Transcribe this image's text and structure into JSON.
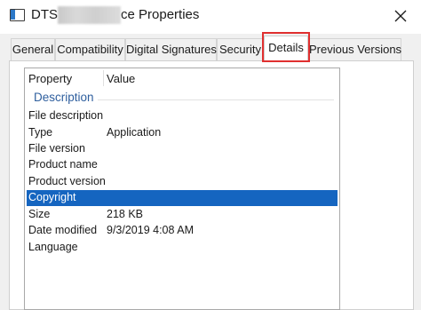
{
  "window": {
    "title_prefix": "DTS",
    "title_suffix": "ce Properties",
    "close_glyph": "close-icon"
  },
  "tabs": [
    {
      "label": "General",
      "active": false
    },
    {
      "label": "Compatibility",
      "active": false
    },
    {
      "label": "Digital Signatures",
      "active": false
    },
    {
      "label": "Security",
      "active": false
    },
    {
      "label": "Details",
      "active": true
    },
    {
      "label": "Previous Versions",
      "active": false
    }
  ],
  "details": {
    "headers": {
      "property": "Property",
      "value": "Value"
    },
    "group": "Description",
    "rows": [
      {
        "property": "File description",
        "value": ""
      },
      {
        "property": "Type",
        "value": "Application"
      },
      {
        "property": "File version",
        "value": ""
      },
      {
        "property": "Product name",
        "value": ""
      },
      {
        "property": "Product version",
        "value": ""
      },
      {
        "property": "Copyright",
        "value": "",
        "selected": true
      },
      {
        "property": "Size",
        "value": "218 KB"
      },
      {
        "property": "Date modified",
        "value": "9/3/2019 4:08 AM"
      },
      {
        "property": "Language",
        "value": ""
      }
    ]
  },
  "colors": {
    "selection": "#1565c0",
    "group_label": "#2f5f9e",
    "highlight": "#e03030"
  }
}
